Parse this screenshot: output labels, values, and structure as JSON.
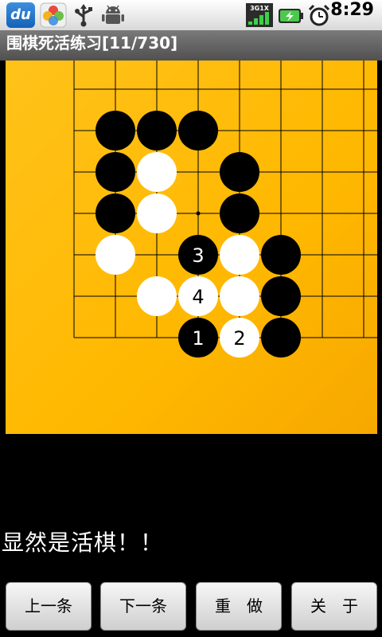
{
  "status_bar": {
    "time": "8:29",
    "icons": [
      "du-app-icon",
      "petal-app-icon",
      "usb-icon",
      "android-debug-icon",
      "signal-icon",
      "battery-icon",
      "alarm-icon"
    ],
    "signal_label": "3G1X",
    "du_label": "du"
  },
  "title": "围棋死活练习[11/730]",
  "board": {
    "background": "#ffbb00",
    "grid_color": "#000000",
    "stones": [
      {
        "color": "black",
        "col": 1,
        "row": 1,
        "label": ""
      },
      {
        "color": "black",
        "col": 2,
        "row": 1,
        "label": ""
      },
      {
        "color": "black",
        "col": 3,
        "row": 1,
        "label": ""
      },
      {
        "color": "black",
        "col": 1,
        "row": 2,
        "label": ""
      },
      {
        "color": "white",
        "col": 2,
        "row": 2,
        "label": ""
      },
      {
        "color": "black",
        "col": 4,
        "row": 2,
        "label": ""
      },
      {
        "color": "black",
        "col": 1,
        "row": 3,
        "label": ""
      },
      {
        "color": "white",
        "col": 2,
        "row": 3,
        "label": ""
      },
      {
        "color": "black",
        "col": 4,
        "row": 3,
        "label": ""
      },
      {
        "color": "white",
        "col": 1,
        "row": 4,
        "label": ""
      },
      {
        "color": "black",
        "col": 3,
        "row": 4,
        "label": "3"
      },
      {
        "color": "white",
        "col": 4,
        "row": 4,
        "label": ""
      },
      {
        "color": "black",
        "col": 5,
        "row": 4,
        "label": ""
      },
      {
        "color": "white",
        "col": 2,
        "row": 5,
        "label": ""
      },
      {
        "color": "white",
        "col": 3,
        "row": 5,
        "label": "4"
      },
      {
        "color": "white",
        "col": 4,
        "row": 5,
        "label": ""
      },
      {
        "color": "black",
        "col": 5,
        "row": 5,
        "label": ""
      },
      {
        "color": "black",
        "col": 3,
        "row": 6,
        "label": "1"
      },
      {
        "color": "white",
        "col": 4,
        "row": 6,
        "label": "2"
      },
      {
        "color": "black",
        "col": 5,
        "row": 6,
        "label": ""
      }
    ]
  },
  "message": "显然是活棋！！",
  "buttons": {
    "prev": "上一条",
    "next": "下一条",
    "redo": "重　做",
    "about": "关　于"
  }
}
